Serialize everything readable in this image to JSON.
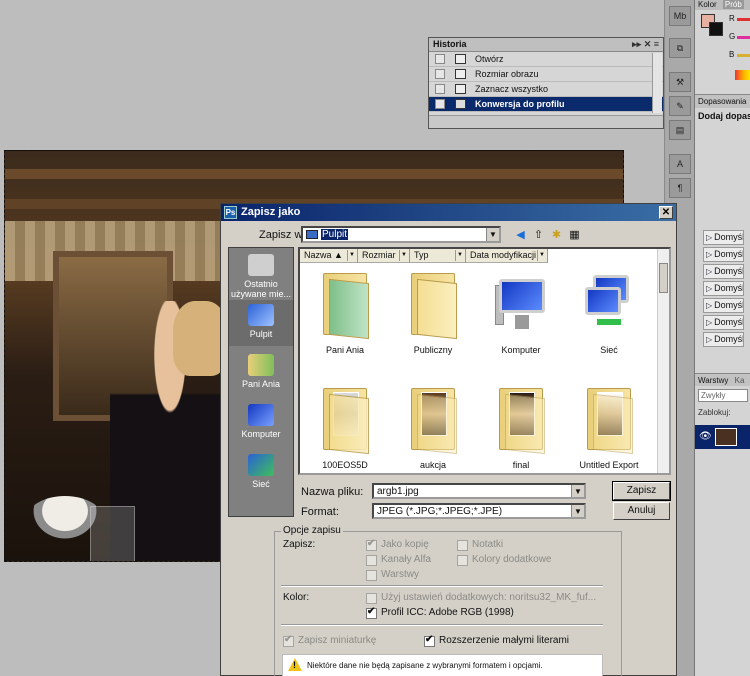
{
  "historia": {
    "title": "Historia",
    "items": [
      {
        "label": "Otwórz"
      },
      {
        "label": "Rozmiar obrazu"
      },
      {
        "label": "Zaznacz wszystko"
      },
      {
        "label": "Konwersja do profilu",
        "selected": true
      }
    ]
  },
  "right_panel": {
    "kolor_tab": "Kolor",
    "probki_tab": "Prób",
    "r_label": "R",
    "g_label": "G",
    "b_label": "B",
    "dopasowania_tab": "Dopasowania",
    "dodaj_label": "Dodaj dopaso",
    "preset_items": [
      "Domyśln",
      "Domyśln",
      "Domyśln",
      "Domyśln",
      "Domyśln",
      "Domyśln",
      "Domyśln"
    ],
    "warstwy_tab": "Warstwy",
    "ka_tab": "Ka",
    "blend_mode": "Zwykły",
    "zablokuj_label": "Zablokuj:"
  },
  "dialog": {
    "title": "Zapisz jako",
    "app_icon": "Ps",
    "close": "✕",
    "zapisz_w_label": "Zapisz w:",
    "zapisz_w_value": "Pulpit",
    "columns": [
      "Nazwa",
      "Rozmiar",
      "Typ",
      "Data modyfikacji"
    ],
    "places": [
      {
        "label": "Ostatnio używane mie..."
      },
      {
        "label": "Pulpit"
      },
      {
        "label": "Pani Ania"
      },
      {
        "label": "Komputer"
      },
      {
        "label": "Sieć"
      }
    ],
    "files": [
      {
        "name": "Pani Ania"
      },
      {
        "name": "Publiczny"
      },
      {
        "name": "Komputer"
      },
      {
        "name": "Sieć"
      },
      {
        "name": "100EOS5D"
      },
      {
        "name": "aukcja"
      },
      {
        "name": "final"
      },
      {
        "name": "Untitled Export"
      }
    ],
    "nazwa_pliku_label": "Nazwa pliku:",
    "nazwa_pliku_value": "argb1.jpg",
    "format_label": "Format:",
    "format_value": "JPEG (*.JPG;*.JPEG;*.JPE)",
    "save_button": "Zapisz",
    "cancel_button": "Anuluj",
    "options_title": "Opcje zapisu",
    "zapisz_label": "Zapisz:",
    "options": {
      "jako_kopie": "Jako kopię",
      "kanaly_alfa": "Kanały Alfa",
      "warstwy": "Warstwy",
      "notatki": "Notatki",
      "kolory_dodatkowe": "Kolory dodatkowe"
    },
    "kolor_label": "Kolor:",
    "uzyj_ustawien": "Użyj ustawień dodatkowych:  noritsu32_MK_fuf...",
    "profil_icc": "Profil ICC:  Adobe RGB (1998)",
    "zapisz_miniaturke": "Zapisz miniaturkę",
    "rozszerzenie": "Rozszerzenie małymi literami",
    "warning": "Niektóre dane nie będą zapisane z wybranymi formatem i opcjami."
  },
  "colors": {
    "title_bar": "#0a246a",
    "history_selected": "#0b2a6b",
    "dialog_bg": "#d4d0c8"
  }
}
